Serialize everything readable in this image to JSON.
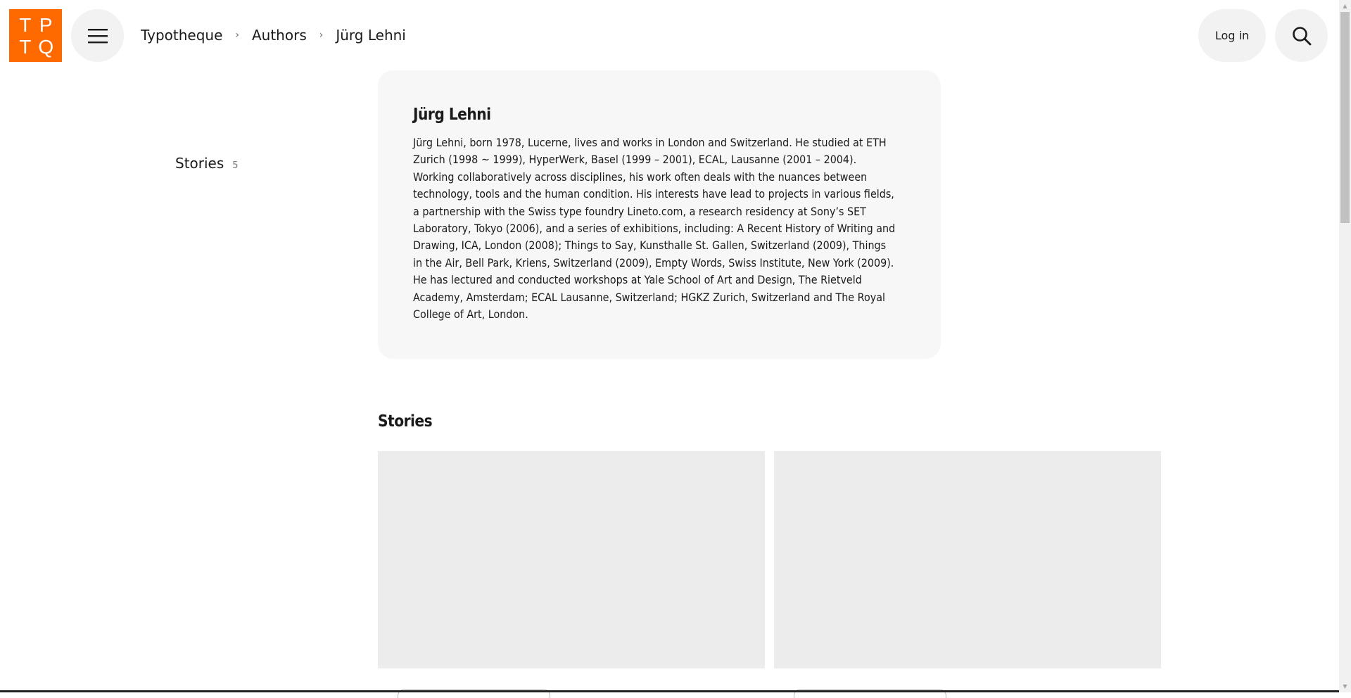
{
  "logo": {
    "letters": [
      "T",
      "P",
      "T",
      "Q"
    ]
  },
  "header": {
    "menu_icon": "hamburger-menu-icon",
    "search_icon": "magnifier-search-icon",
    "login_label": "Log in"
  },
  "breadcrumb": {
    "items": [
      "Typotheque",
      "Authors",
      "Jürg Lehni"
    ],
    "separator": "›"
  },
  "side_nav": {
    "label": "Stories",
    "count": "5"
  },
  "author": {
    "name": "Jürg Lehni",
    "bio": "Jürg Lehni, born 1978, Lucerne, lives and works in London and Switzerland. He studied at ETH Zurich (1998 ~ 1999), HyperWerk, Basel (1999 – 2001), ECAL, Lausanne (2001 – 2004). Working collaboratively across disciplines, his work often deals with the nuances between technology, tools and the human condition. His interests have lead to projects in various fields, a partnership with the Swiss type foundry Lineto.com, a research residency at Sony’s SET Laboratory, Tokyo (2006), and a series of exhibitions, including: A Recent History of Writing and Drawing, ICA, London (2008); Things to Say, Kunsthalle St. Gallen, Switzerland (2009), Things in the Air, Bell Park, Kriens, Switzerland (2009), Empty Words, Swiss Institute, New York (2009). He has lectured and conducted workshops at Yale School of Art and Design, The Rietveld Academy, Amsterdam; ECAL Lausanne, Switzerland; HGKZ Zurich, Switzerland and The Royal College of Art, London."
  },
  "stories": {
    "heading": "Stories"
  },
  "colors": {
    "brand": "#ff6a00",
    "card_bg": "#f7f7f7",
    "placeholder_bg": "#ececec"
  }
}
